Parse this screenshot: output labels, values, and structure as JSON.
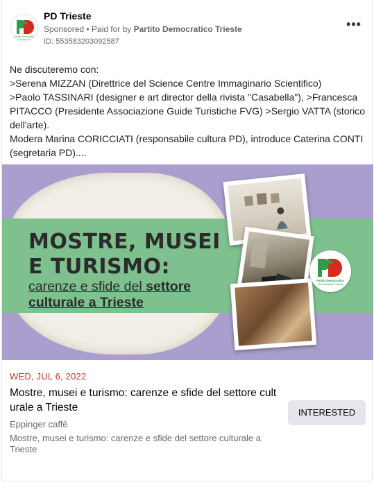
{
  "header": {
    "page_name": "PD Trieste",
    "sponsored": "Sponsored",
    "paid_for_prefix": " • Paid for by ",
    "paid_for_by": "Partito Democratico Trieste",
    "ad_id": "ID: 553583203092587",
    "more_label": "•••"
  },
  "body": {
    "lines": [
      "Ne discuteremo con:",
      ">Serena MIZZAN (Direttrice del Science Centre Immaginario Scientifico)",
      ">Paolo TASSINARI (designer e art director della rivista \"Casabella\"), >Francesca PITACCO (Presidente Associazione Guide Turistiche FVG) >Sergio VATTA (storico dell'arte).",
      "Modera Marina CORICCIATI (responsabile cultura PD), introduce Caterina CONTI (segretaria PD)...."
    ]
  },
  "banner": {
    "title_line1": "MOSTRE, MUSEI",
    "title_line2": "E TURISMO:",
    "subtitle_line1_a": "carenze e sfide del ",
    "subtitle_line1_b": "settore",
    "subtitle_line2": "culturale a Trieste",
    "logo_text_small": "Partito Democratico",
    "logo_text_small2": "Demokratska Stranka",
    "colors": {
      "purple": "#a99ecd",
      "green": "#7fc08f",
      "logo_green": "#2e9d4c",
      "logo_red": "#d52b1e"
    }
  },
  "event": {
    "date": "WED, JUL 6, 2022",
    "title": "Mostre, musei e turismo: carenze e sfide del settore cult urale a Trieste",
    "venue": "Eppinger caffè",
    "description": "Mostre, musei e turismo: carenze e sfide del settore culturale a Trieste",
    "button_label": "INTERESTED"
  },
  "avatar_logo": {
    "text1": "Partito Democratico",
    "text2": "Demokratska Stranka"
  }
}
